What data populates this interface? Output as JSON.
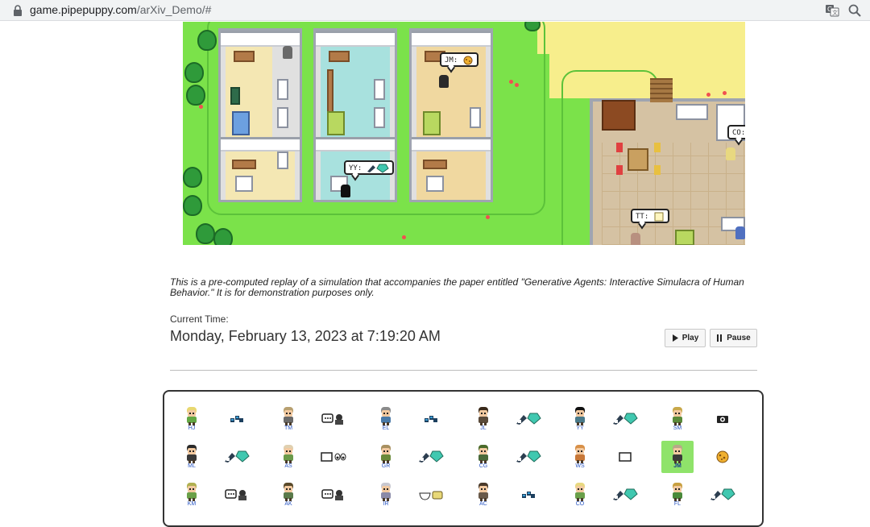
{
  "browser": {
    "url_host": "game.pipepuppy.com",
    "url_path": "/arXiv_Demo/#"
  },
  "map": {
    "bubbles": [
      {
        "id": "jm",
        "initials": "JM:"
      },
      {
        "id": "yy",
        "initials": "YY:"
      },
      {
        "id": "co",
        "initials": "CO:"
      },
      {
        "id": "tt",
        "initials": "TT:"
      }
    ]
  },
  "caption": "This is a pre-computed replay of a simulation that accompanies the paper entitled \"Generative Agents: Interactive Simulacra of Human Behavior.\" It is for demonstration purposes only.",
  "time": {
    "label": "Current Time:",
    "value": "Monday, February 13, 2023 at 7:19:20 AM"
  },
  "controls": {
    "play_label": "Play",
    "pause_label": "Pause"
  },
  "agents": {
    "selected": "JM",
    "rows": [
      [
        {
          "initials": "HJ",
          "hair": "#e8d870",
          "shirt": "#64a844",
          "action": "sleep-icon"
        },
        {
          "initials": "TM",
          "hair": "#b8a070",
          "shirt": "#6a6a6a",
          "action": "speech-bubble-icon"
        },
        {
          "initials": "EL",
          "hair": "#8a8a8a",
          "shirt": "#4a7aa8",
          "action": "sleep-icon"
        },
        {
          "initials": "JL",
          "hair": "#3a2a1a",
          "shirt": "#5a4a3a",
          "action": "brush-and-gem-icon"
        },
        {
          "initials": "YY",
          "hair": "#111111",
          "shirt": "#4a7a8a",
          "action": "brush-and-gem-icon"
        },
        {
          "initials": "SM",
          "hair": "#c8a84a",
          "shirt": "#5a8a3a",
          "action": "camera-icon"
        }
      ],
      [
        {
          "initials": "ML",
          "hair": "#2a2a2a",
          "shirt": "#3a3a3a",
          "action": "brush-and-gem-icon"
        },
        {
          "initials": "AS",
          "hair": "#e0d0b0",
          "shirt": "#6a9a4a",
          "action": "book-and-eyes-icon"
        },
        {
          "initials": "GR",
          "hair": "#a89060",
          "shirt": "#6a8a3a",
          "action": "brush-and-gem-icon"
        },
        {
          "initials": "CG",
          "hair": "#4a6a2a",
          "shirt": "#4a6a3a",
          "action": "brush-and-gem-icon"
        },
        {
          "initials": "WS",
          "hair": "#d89048",
          "shirt": "#c87838",
          "action": "book-icon"
        },
        {
          "initials": "JM",
          "hair": "#b8a888",
          "shirt": "#3a3a3a",
          "action": "cookie-icon"
        }
      ],
      [
        {
          "initials": "KM",
          "hair": "#b0b050",
          "shirt": "#6aa048",
          "action": "speech-bubble-icon"
        },
        {
          "initials": "AK",
          "hair": "#5a4a2a",
          "shirt": "#5a7a4a",
          "action": "speech-bubble-icon"
        },
        {
          "initials": "IR",
          "hair": "#c8c8d0",
          "shirt": "#8a8aa8",
          "action": "bowl-and-cake-icon"
        },
        {
          "initials": "AC",
          "hair": "#4a3a2a",
          "shirt": "#6a5a4a",
          "action": "sleep-icon"
        },
        {
          "initials": "CO",
          "hair": "#e8d880",
          "shirt": "#6aa04a",
          "action": "brush-and-gem-icon"
        },
        {
          "initials": "FL",
          "hair": "#c8a040",
          "shirt": "#4a8a3a",
          "action": "brush-and-gem-icon"
        }
      ]
    ]
  }
}
